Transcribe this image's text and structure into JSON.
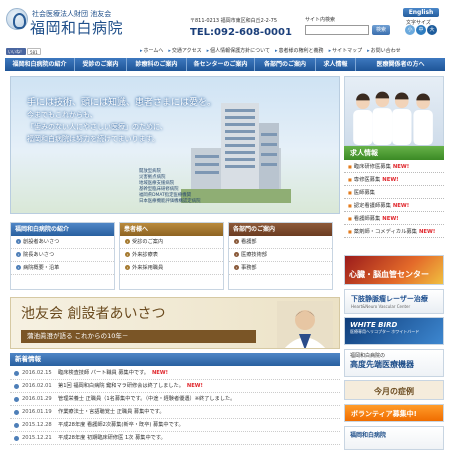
{
  "header": {
    "corp_name": "社会医療法人財団 池友会",
    "hospital_name": "福岡和白病院",
    "address": "〒811-0213 福岡市東区和白丘2-2-75",
    "tel": "TEL:092-608-0001",
    "search_label": "サイト内検索",
    "search_button": "検索",
    "english": "English",
    "font_size_label": "文字サイズ",
    "font_small": "小",
    "font_mid": "中",
    "font_large": "大"
  },
  "social": {
    "like": "いいね！",
    "count": "581"
  },
  "toplinks": [
    "ホームへ",
    "交通アクセス",
    "個人情報保護方針について",
    "患者様の権利と義務",
    "サイトマップ",
    "お問い合わせ"
  ],
  "nav": [
    "福岡和白病院の紹介",
    "受診のご案内",
    "診療科のご案内",
    "各センターのご案内",
    "各部門のご案内",
    "求人情報",
    "医療関係者の方へ"
  ],
  "hero": {
    "line1": "手には技術、頭には知識、患者さまには愛を。",
    "line2": "今までもこれからも、",
    "line3": "「歯みのない人にやさしい医療」のために、",
    "line4": "福岡和白病院は努力を続けてまいります。",
    "badges": [
      "開放型病院",
      "災害拠点病院",
      "地域医療支援病院",
      "基幹型臨床研修病院",
      "福岡県DMAT指定医療機関",
      "日本医療機能評価機構認定病院"
    ]
  },
  "recruit": {
    "heading": "求人情報",
    "new_label": "NEW!",
    "items": [
      {
        "label": "臨床研修医募集",
        "new": true
      },
      {
        "label": "専修医募集",
        "new": true
      },
      {
        "label": "医師募集",
        "new": false
      },
      {
        "label": "認定看護師募集",
        "new": true
      },
      {
        "label": "看護師募集",
        "new": true
      },
      {
        "label": "薬剤師・コメディカル募集",
        "new": true
      }
    ]
  },
  "departments": {
    "intro": {
      "title": "福岡和白病院の紹介",
      "items": [
        "創設者あいさつ",
        "院長あいさつ",
        "病院概要・沿革"
      ]
    },
    "patients": {
      "title": "患者様へ",
      "items": [
        "受診のご案内",
        "外来診療表",
        "外来採用職員"
      ]
    },
    "sections": {
      "title": "各部門のご案内",
      "items": [
        "看護部",
        "医療技術部",
        "事務部"
      ]
    }
  },
  "founder": {
    "title": "池友会 創設者あいさつ",
    "subtitle": "蒲池眞澄が語る これからの10年－"
  },
  "news": {
    "heading": "新着情報",
    "new_label": "NEW!",
    "rows": [
      {
        "date": "2016.02.15",
        "title": "臨床検査技師 パート職員 募集中です。",
        "new": true
      },
      {
        "date": "2016.02.01",
        "title": "第1回 福岡和白病院 鍵和マラ研修会は終了しました。",
        "new": true
      },
      {
        "date": "2016.01.29",
        "title": "管理栄養士 正職員（1名募集中です。（中途・経験者優遇）※終了しました。",
        "new": false
      },
      {
        "date": "2016.01.19",
        "title": "作業療法士・言語聴覚士 正職員 募集中です。",
        "new": false
      },
      {
        "date": "2015.12.28",
        "title": "平成28年度 看護師2次募集(新卒・既卒) 募集中です。",
        "new": false
      },
      {
        "date": "2015.12.21",
        "title": "平成28年度 初期臨床研修医 1次 募集中です。",
        "new": false
      }
    ]
  },
  "banners": {
    "heart": "心臓・脳血管センター",
    "varicose": "下肢静脈瘤レーザー治療",
    "varicose_sub": "Heart&Neuro Vascular Center",
    "whitebird": "WHITE BIRD",
    "whitebird_sub": "医療専用ヘリコプター ホワイトバード",
    "equipment_top": "福岡和白病院の",
    "equipment": "高度先端医療機器",
    "cases": "今月の症例",
    "volunteer": "ボランティア募集中!",
    "bottom": "福岡和白病院",
    "colors": {
      "brand": "#1f4f8a",
      "nav": "#2e68ad",
      "recruit": "#4f9a35",
      "new": "#e0262c"
    }
  }
}
